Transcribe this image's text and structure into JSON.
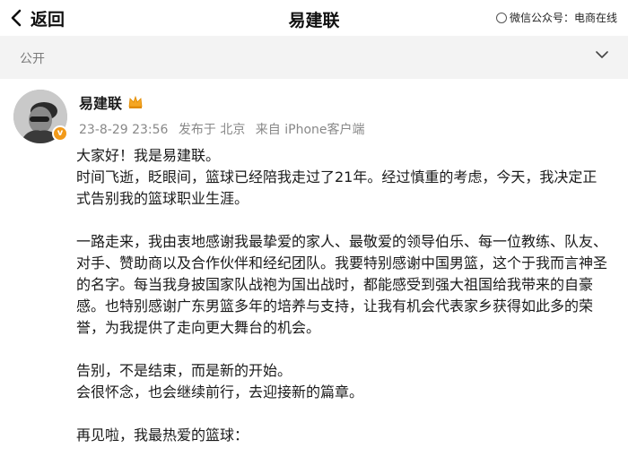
{
  "topbar": {
    "back_label": "返回",
    "title": "易建联",
    "watermark": "微信公众号：电商在线"
  },
  "filter": {
    "label": "公开"
  },
  "post": {
    "author": "易建联",
    "meta": {
      "time": "23-8-29 23:56",
      "location": "发布于 北京",
      "source": "来自 iPhone客户端"
    },
    "paragraphs": [
      [
        "大家好！我是易建联。",
        "时间飞逝，眨眼间，篮球已经陪我走过了21年。经过慎重的考虑，今天，我决定正式告别我的篮球职业生涯。"
      ],
      [
        "一路走来，我由衷地感谢我最挚爱的家人、最敬爱的领导伯乐、每一位教练、队友、对手、赞助商以及合作伙伴和经纪团队。我要特别感谢中国男篮，这个于我而言神圣的名字。每当我身披国家队战袍为国出战时，都能感受到强大祖国给我带来的自豪感。也特别感谢广东男篮多年的培养与支持，让我有机会代表家乡获得如此多的荣誉，为我提供了走向更大舞台的机会。"
      ],
      [
        "告别，不是结束，而是新的开始。",
        "会很怀念，也会继续前行，去迎接新的篇章。"
      ],
      [
        "再见啦，我最热爱的篮球："
      ]
    ]
  },
  "colors": {
    "accent_badge": "#f29a1a",
    "filter_bg": "#f3f3f3",
    "meta_text": "#888888"
  },
  "icons": [
    "back-arrow-icon",
    "chevron-down-icon",
    "crown-icon",
    "verified-badge-icon",
    "wechat-icon"
  ]
}
